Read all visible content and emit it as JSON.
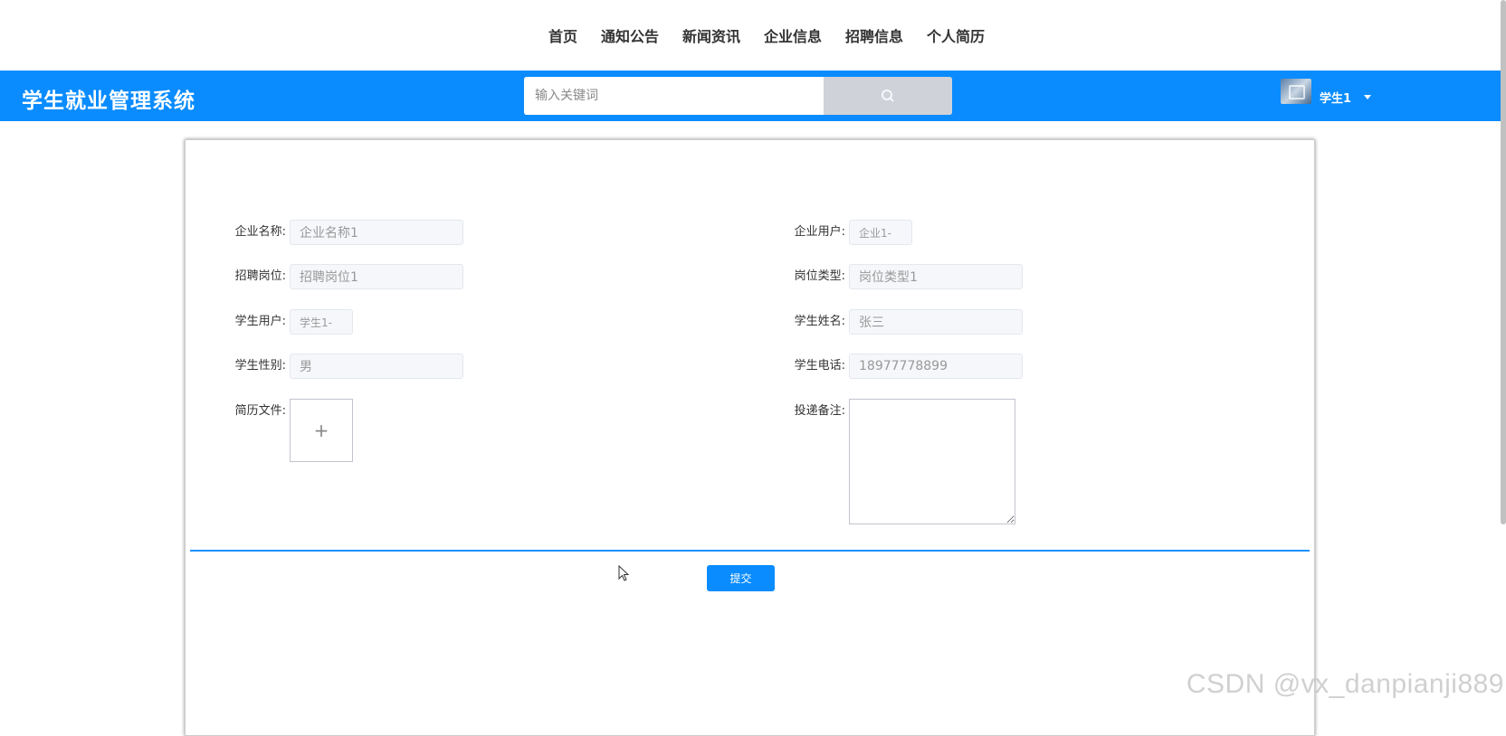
{
  "nav": {
    "items": [
      {
        "label": "首页"
      },
      {
        "label": "通知公告"
      },
      {
        "label": "新闻资讯"
      },
      {
        "label": "企业信息"
      },
      {
        "label": "招聘信息"
      },
      {
        "label": "个人简历"
      }
    ]
  },
  "header": {
    "brand": "学生就业管理系统",
    "search_placeholder": "输入关键词",
    "search_icon": "search-icon",
    "username": "学生1",
    "bg_color": "#0a8cff"
  },
  "form": {
    "company_name": {
      "label": "企业名称:",
      "value": "企业名称1"
    },
    "company_user": {
      "label": "企业用户:",
      "value": "企业1-"
    },
    "job_position": {
      "label": "招聘岗位:",
      "value": "招聘岗位1"
    },
    "job_type": {
      "label": "岗位类型:",
      "value": "岗位类型1"
    },
    "student_user": {
      "label": "学生用户:",
      "value": "学生1-"
    },
    "student_name": {
      "label": "学生姓名:",
      "value": "张三"
    },
    "student_gender": {
      "label": "学生性别:",
      "value": "男"
    },
    "student_phone": {
      "label": "学生电话:",
      "value": "18977778899"
    },
    "resume_file": {
      "label": "简历文件:",
      "upload_icon": "+"
    },
    "remark": {
      "label": "投递备注:",
      "value": ""
    },
    "submit_label": "提交"
  },
  "watermark": "CSDN @vx_danpianji889"
}
